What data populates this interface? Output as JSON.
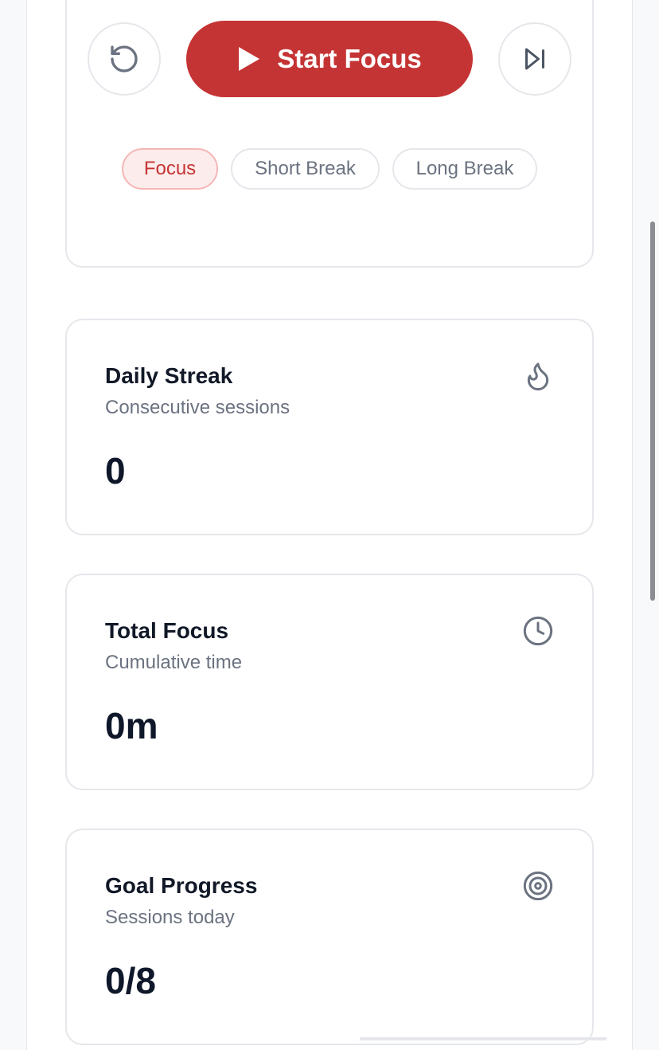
{
  "controls": {
    "reset_icon": "reset-icon",
    "start_label": "Start Focus",
    "start_icon": "play-icon",
    "skip_icon": "skip-next-icon",
    "accent_color": "#c53434"
  },
  "modes": [
    {
      "label": "Focus",
      "active": true
    },
    {
      "label": "Short Break",
      "active": false
    },
    {
      "label": "Long Break",
      "active": false
    }
  ],
  "stats": {
    "streak": {
      "title": "Daily Streak",
      "subtitle": "Consecutive sessions",
      "value": "0",
      "icon": "flame-icon"
    },
    "total": {
      "title": "Total Focus",
      "subtitle": "Cumulative time",
      "value": "0m",
      "icon": "clock-icon"
    },
    "goal": {
      "title": "Goal Progress",
      "subtitle": "Sessions today",
      "value": "0/8",
      "icon": "target-icon"
    }
  }
}
